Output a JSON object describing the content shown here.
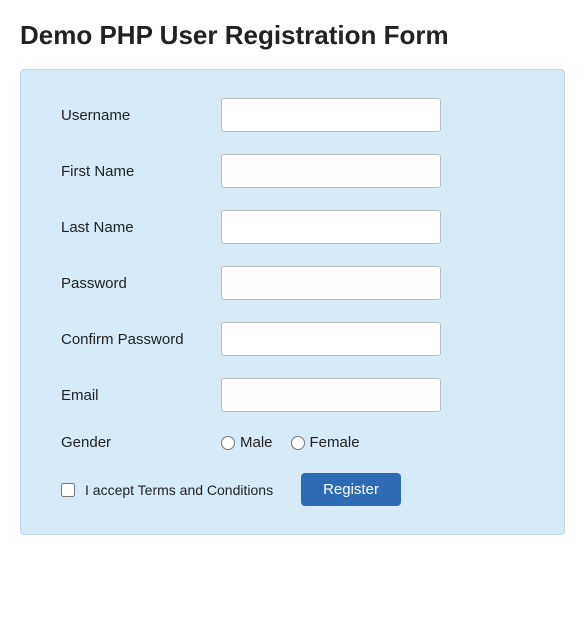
{
  "page": {
    "title": "Demo PHP User Registration Form"
  },
  "form": {
    "fields": [
      {
        "label": "Username",
        "type": "text",
        "name": "username"
      },
      {
        "label": "First Name",
        "type": "text",
        "name": "first_name"
      },
      {
        "label": "Last Name",
        "type": "text",
        "name": "last_name"
      },
      {
        "label": "Password",
        "type": "password",
        "name": "password"
      },
      {
        "label": "Confirm Password",
        "type": "password",
        "name": "confirm_password"
      },
      {
        "label": "Email",
        "type": "text",
        "name": "email"
      }
    ],
    "gender": {
      "label": "Gender",
      "options": [
        "Male",
        "Female"
      ]
    },
    "terms": {
      "label": "I accept Terms and Conditions"
    },
    "submit": {
      "label": "Register"
    }
  }
}
